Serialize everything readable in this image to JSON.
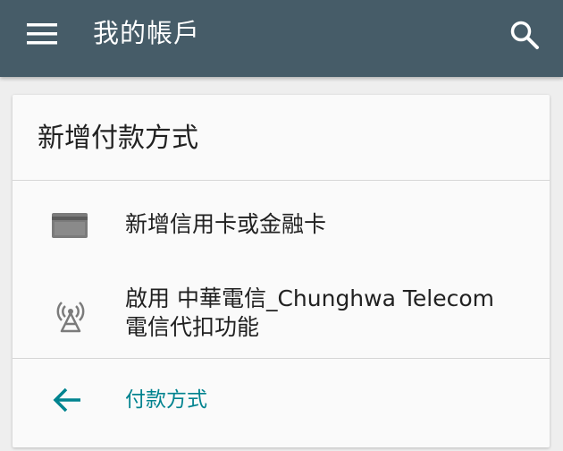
{
  "appbar": {
    "title": "我的帳戶",
    "menu_icon": "hamburger-menu-icon",
    "search_icon": "search-icon",
    "background_color": "#465c68"
  },
  "card": {
    "title": "新增付款方式",
    "options": [
      {
        "icon": "credit-card-icon",
        "label": "新增信用卡或金融卡"
      },
      {
        "icon": "cell-tower-icon",
        "label_line1": "啟用 中華電信_Chunghwa Telecom",
        "label_line2": "電信代扣功能"
      }
    ],
    "footer": {
      "icon": "arrow-back-icon",
      "label": "付款方式",
      "accent_color": "#00838f"
    }
  }
}
